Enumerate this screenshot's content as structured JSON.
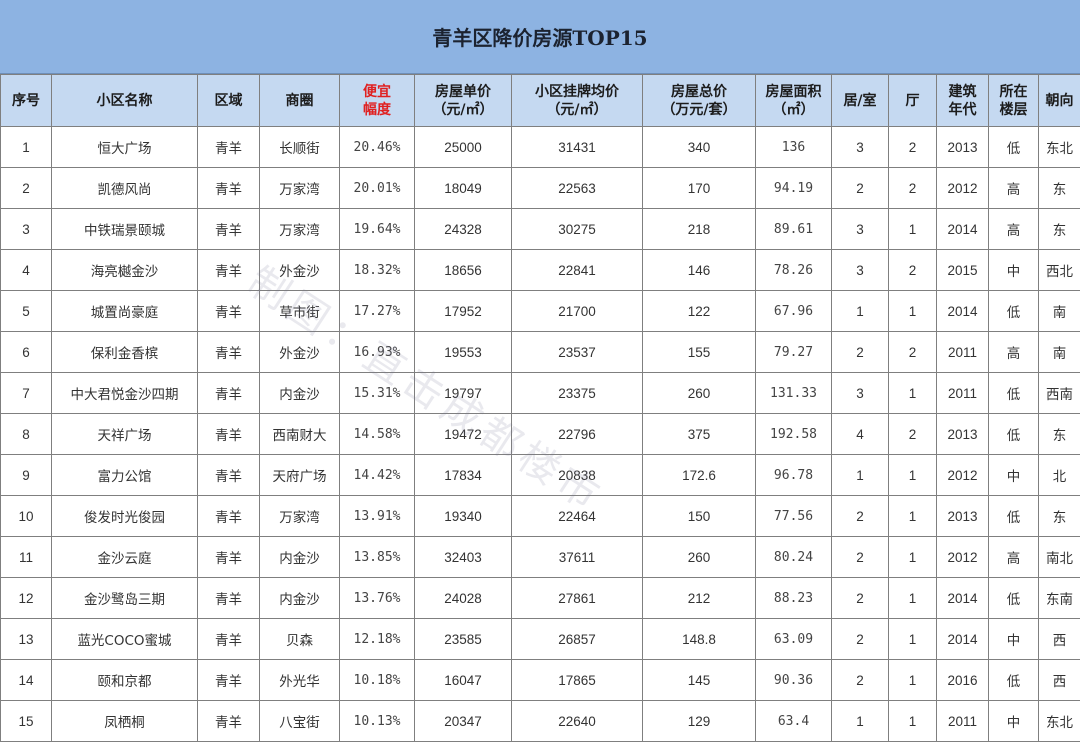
{
  "title": "青羊区降价房源TOP15",
  "watermark": "制图：直击成都楼市",
  "headers": {
    "index": "序号",
    "community": "小区名称",
    "area": "区域",
    "district": "商圈",
    "discount": "便宜幅度",
    "unit_price": "房屋单价（元/㎡）",
    "avg_price": "小区挂牌均价（元/㎡）",
    "total_price": "房屋总价（万元/套）",
    "size": "房屋面积（㎡）",
    "bedrooms": "居/室",
    "living": "厅",
    "year": "建筑年代",
    "floor": "所在楼层",
    "orientation": "朝向"
  },
  "rows": [
    {
      "index": "1",
      "community": "恒大广场",
      "area": "青羊",
      "district": "长顺街",
      "discount": "20.46%",
      "unit_price": "25000",
      "avg_price": "31431",
      "total_price": "340",
      "size": "136",
      "bedrooms": "3",
      "living": "2",
      "year": "2013",
      "floor": "低",
      "orientation": "东北"
    },
    {
      "index": "2",
      "community": "凯德风尚",
      "area": "青羊",
      "district": "万家湾",
      "discount": "20.01%",
      "unit_price": "18049",
      "avg_price": "22563",
      "total_price": "170",
      "size": "94.19",
      "bedrooms": "2",
      "living": "2",
      "year": "2012",
      "floor": "高",
      "orientation": "东"
    },
    {
      "index": "3",
      "community": "中铁瑞景颐城",
      "area": "青羊",
      "district": "万家湾",
      "discount": "19.64%",
      "unit_price": "24328",
      "avg_price": "30275",
      "total_price": "218",
      "size": "89.61",
      "bedrooms": "3",
      "living": "1",
      "year": "2014",
      "floor": "高",
      "orientation": "东"
    },
    {
      "index": "4",
      "community": "海亮樾金沙",
      "area": "青羊",
      "district": "外金沙",
      "discount": "18.32%",
      "unit_price": "18656",
      "avg_price": "22841",
      "total_price": "146",
      "size": "78.26",
      "bedrooms": "3",
      "living": "2",
      "year": "2015",
      "floor": "中",
      "orientation": "西北"
    },
    {
      "index": "5",
      "community": "城置尚豪庭",
      "area": "青羊",
      "district": "草市街",
      "discount": "17.27%",
      "unit_price": "17952",
      "avg_price": "21700",
      "total_price": "122",
      "size": "67.96",
      "bedrooms": "1",
      "living": "1",
      "year": "2014",
      "floor": "低",
      "orientation": "南"
    },
    {
      "index": "6",
      "community": "保利金香槟",
      "area": "青羊",
      "district": "外金沙",
      "discount": "16.93%",
      "unit_price": "19553",
      "avg_price": "23537",
      "total_price": "155",
      "size": "79.27",
      "bedrooms": "2",
      "living": "2",
      "year": "2011",
      "floor": "高",
      "orientation": "南"
    },
    {
      "index": "7",
      "community": "中大君悦金沙四期",
      "area": "青羊",
      "district": "内金沙",
      "discount": "15.31%",
      "unit_price": "19797",
      "avg_price": "23375",
      "total_price": "260",
      "size": "131.33",
      "bedrooms": "3",
      "living": "1",
      "year": "2011",
      "floor": "低",
      "orientation": "西南"
    },
    {
      "index": "8",
      "community": "天祥广场",
      "area": "青羊",
      "district": "西南财大",
      "discount": "14.58%",
      "unit_price": "19472",
      "avg_price": "22796",
      "total_price": "375",
      "size": "192.58",
      "bedrooms": "4",
      "living": "2",
      "year": "2013",
      "floor": "低",
      "orientation": "东"
    },
    {
      "index": "9",
      "community": "富力公馆",
      "area": "青羊",
      "district": "天府广场",
      "discount": "14.42%",
      "unit_price": "17834",
      "avg_price": "20838",
      "total_price": "172.6",
      "size": "96.78",
      "bedrooms": "1",
      "living": "1",
      "year": "2012",
      "floor": "中",
      "orientation": "北"
    },
    {
      "index": "10",
      "community": "俊发时光俊园",
      "area": "青羊",
      "district": "万家湾",
      "discount": "13.91%",
      "unit_price": "19340",
      "avg_price": "22464",
      "total_price": "150",
      "size": "77.56",
      "bedrooms": "2",
      "living": "1",
      "year": "2013",
      "floor": "低",
      "orientation": "东"
    },
    {
      "index": "11",
      "community": "金沙云庭",
      "area": "青羊",
      "district": "内金沙",
      "discount": "13.85%",
      "unit_price": "32403",
      "avg_price": "37611",
      "total_price": "260",
      "size": "80.24",
      "bedrooms": "2",
      "living": "1",
      "year": "2012",
      "floor": "高",
      "orientation": "南北"
    },
    {
      "index": "12",
      "community": "金沙鹭岛三期",
      "area": "青羊",
      "district": "内金沙",
      "discount": "13.76%",
      "unit_price": "24028",
      "avg_price": "27861",
      "total_price": "212",
      "size": "88.23",
      "bedrooms": "2",
      "living": "1",
      "year": "2014",
      "floor": "低",
      "orientation": "东南"
    },
    {
      "index": "13",
      "community": "蓝光COCO蜜城",
      "area": "青羊",
      "district": "贝森",
      "discount": "12.18%",
      "unit_price": "23585",
      "avg_price": "26857",
      "total_price": "148.8",
      "size": "63.09",
      "bedrooms": "2",
      "living": "1",
      "year": "2014",
      "floor": "中",
      "orientation": "西"
    },
    {
      "index": "14",
      "community": "颐和京都",
      "area": "青羊",
      "district": "外光华",
      "discount": "10.18%",
      "unit_price": "16047",
      "avg_price": "17865",
      "total_price": "145",
      "size": "90.36",
      "bedrooms": "2",
      "living": "1",
      "year": "2016",
      "floor": "低",
      "orientation": "西"
    },
    {
      "index": "15",
      "community": "凤栖桐",
      "area": "青羊",
      "district": "八宝街",
      "discount": "10.13%",
      "unit_price": "20347",
      "avg_price": "22640",
      "total_price": "129",
      "size": "63.4",
      "bedrooms": "1",
      "living": "1",
      "year": "2011",
      "floor": "中",
      "orientation": "东北"
    }
  ],
  "colors": {
    "title_bg": "#8db3e2",
    "header_bg": "#c5d9f1",
    "discount_header": "#e02020",
    "grid": "#7f7f7f"
  }
}
